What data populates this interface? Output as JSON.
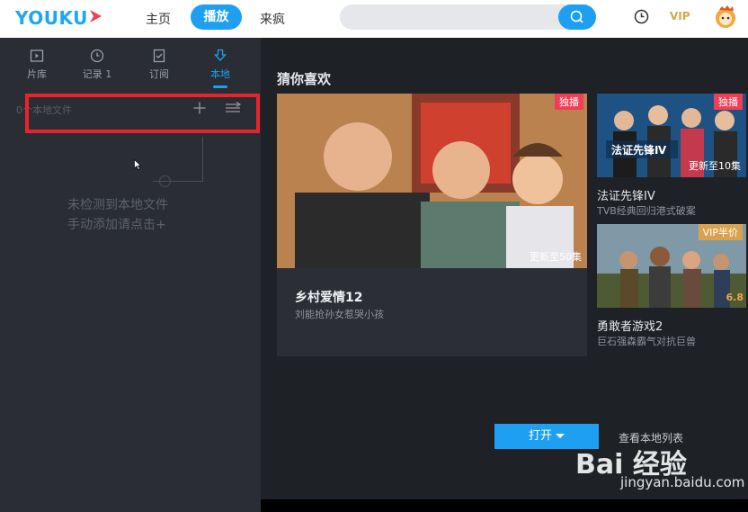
{
  "header": {
    "logo": "YOUKU",
    "nav": [
      "主页",
      "播放",
      "来疯"
    ],
    "vip": "VIP",
    "colors": {
      "accent": "#1e9ff2",
      "vip": "#d8a64a"
    },
    "icons": {
      "search": "search-icon",
      "history": "history-icon",
      "avatar": "avatar-icon"
    }
  },
  "sidebar": {
    "tabs": [
      "片库",
      "记录 1",
      "订阅",
      "本地"
    ],
    "active_tab": "本地",
    "file_count": "0个本地文件",
    "empty_line1": "未检测到本地文件",
    "empty_line2": "手动添加请点击+",
    "icons": {
      "add": "plus-icon",
      "sort": "sort-icon"
    }
  },
  "main": {
    "section_title": "猜你喜欢",
    "feature": {
      "badge": "独播",
      "update": "更新至50集",
      "title": "乡村爱情12",
      "subtitle": "刘能抢孙女惹哭小孩"
    },
    "cards": [
      {
        "badge": "独播",
        "update": "更新至10集",
        "title": "法证先锋IV",
        "subtitle": "TVB经典回归港式破案"
      },
      {
        "badge": "VIP半价",
        "score": "6.8",
        "title": "勇敢者游戏2",
        "subtitle": "巨石强森霸气对抗巨兽"
      }
    ],
    "open_button": "打开",
    "view_list": "查看本地列表"
  },
  "watermark": {
    "brand": "Bai  经验",
    "url": "jingyan.baidu.com"
  }
}
